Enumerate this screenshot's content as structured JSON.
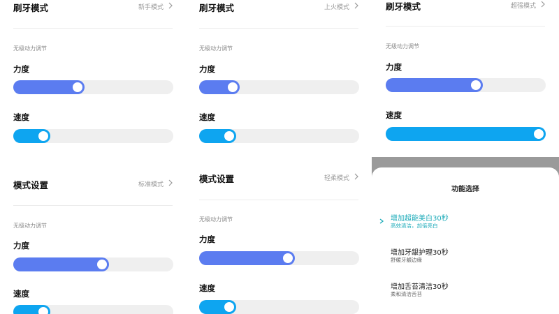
{
  "panel1": {
    "mode1": {
      "title": "刷牙模式",
      "value": "新手模式"
    },
    "section1": {
      "hint": "无级动力调节",
      "strength_label": "力度",
      "speed_label": "速度",
      "strength_level": 0.39,
      "speed_level": 0.16
    },
    "mode2": {
      "title": "模式设置",
      "value": "标准模式"
    },
    "section2": {
      "hint": "无级动力调节",
      "strength_label": "力度",
      "speed_label": "速度",
      "strength_level": 0.56,
      "speed_level": 0.16
    }
  },
  "panel2": {
    "mode1": {
      "title": "刷牙模式",
      "value": "上火模式"
    },
    "section1": {
      "hint": "无级动力调节",
      "strength_label": "力度",
      "speed_label": "速度",
      "strength_level": 0.18,
      "speed_level": 0.16
    },
    "mode2": {
      "title": "模式设置",
      "value": "轻柔模式"
    },
    "section2": {
      "hint": "无级动力调节",
      "strength_label": "力度",
      "speed_label": "速度",
      "strength_level": 0.56,
      "speed_level": 0.16
    }
  },
  "panel3": {
    "mode1": {
      "title": "刷牙模式",
      "value": "超强模式"
    },
    "section1": {
      "hint": "无级动力调节",
      "strength_label": "力度",
      "speed_label": "速度",
      "strength_level": 0.57,
      "speed_level": 1.0
    },
    "sheet": {
      "title": "功能选择",
      "options": [
        {
          "title": "增加超能美白30秒",
          "subtitle": "高效清洁，加倍亮白",
          "selected": true
        },
        {
          "title": "增加牙龈护理30秒",
          "subtitle": "舒缓牙龈边缘",
          "selected": false
        },
        {
          "title": "增加舌苔清洁30秒",
          "subtitle": "柔和清洁舌苔",
          "selected": false
        }
      ]
    }
  },
  "colors": {
    "slider_blue": "#5b7cf0",
    "slider_cyan": "#0ea5f0",
    "accent_teal": "#1aaab8",
    "track": "#efefef"
  },
  "icons": {
    "chevron": "chevron-right-icon",
    "check": "check-icon"
  }
}
